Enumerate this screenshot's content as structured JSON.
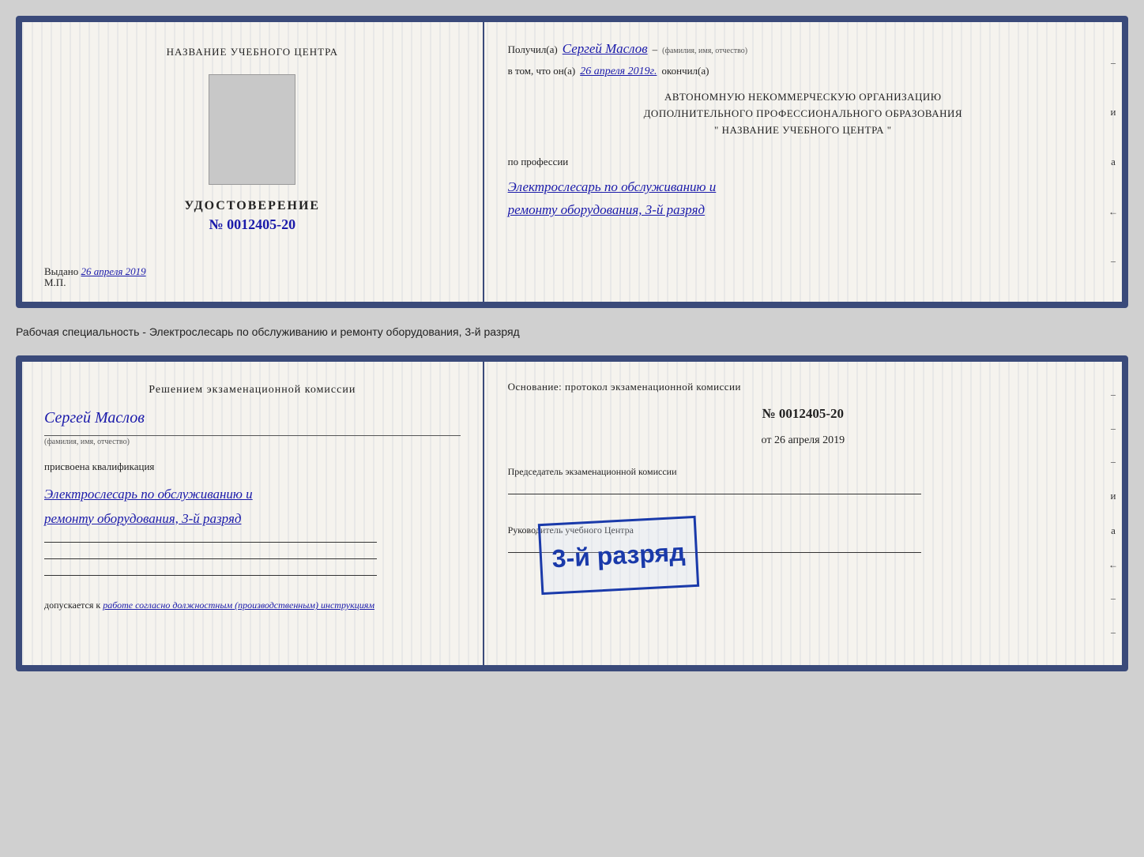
{
  "top_card": {
    "left": {
      "org_title": "НАЗВАНИЕ УЧЕБНОГО ЦЕНТРА",
      "cert_label": "УДОСТОВЕРЕНИЕ",
      "cert_no_prefix": "№",
      "cert_number": "0012405-20",
      "issued_prefix": "Выдано",
      "issued_date": "26 апреля 2019",
      "mp_label": "М.П."
    },
    "right": {
      "received_prefix": "Получил(а)",
      "recipient_name": "Сергей Маслов",
      "recipient_sublabel": "(фамилия, имя, отчество)",
      "dash": "–",
      "date_prefix": "в том, что он(а)",
      "date_value": "26 апреля 2019г.",
      "date_suffix": "окончил(а)",
      "org_line1": "АВТОНОМНУЮ НЕКОММЕРЧЕСКУЮ ОРГАНИЗАЦИЮ",
      "org_line2": "ДОПОЛНИТЕЛЬНОГО ПРОФЕССИОНАЛЬНОГО ОБРАЗОВАНИЯ",
      "org_line3": "\"   НАЗВАНИЕ УЧЕБНОГО ЦЕНТРА   \"",
      "profession_prefix": "по профессии",
      "profession_line1": "Электрослесарь по обслуживанию и",
      "profession_line2": "ремонту оборудования, 3-й разряд"
    }
  },
  "specialty_text": "Рабочая специальность - Электрослесарь по обслуживанию и ремонту оборудования, 3-й разряд",
  "bottom_card": {
    "left": {
      "decision_title": "Решением экзаменационной комиссии",
      "person_name": "Сергей Маслов",
      "person_sublabel": "(фамилия, имя, отчество)",
      "assigned_prefix": "присвоена квалификация",
      "qual_line1": "Электрослесарь по обслуживанию и",
      "qual_line2": "ремонту оборудования, 3-й разряд",
      "allowed_prefix": "допускается к",
      "allowed_text": "работе согласно должностным (производственным) инструкциям"
    },
    "right": {
      "basis_label": "Основание: протокол экзаменационной комиссии",
      "protocol_no": "№  0012405-20",
      "date_prefix": "от",
      "date_value": "26 апреля 2019",
      "chairman_label": "Председатель экзаменационной комиссии",
      "rukovoditel_label": "Руководитель учебного Центра"
    },
    "stamp": {
      "line1": "3-й разряд"
    }
  },
  "right_dashes": [
    "-",
    "–",
    "-",
    "и",
    "а",
    "←",
    "-",
    "-",
    "-"
  ],
  "right_dashes_bottom": [
    "-",
    "-",
    "-",
    "-",
    "и",
    "а",
    "←",
    "-",
    "-",
    "-"
  ]
}
